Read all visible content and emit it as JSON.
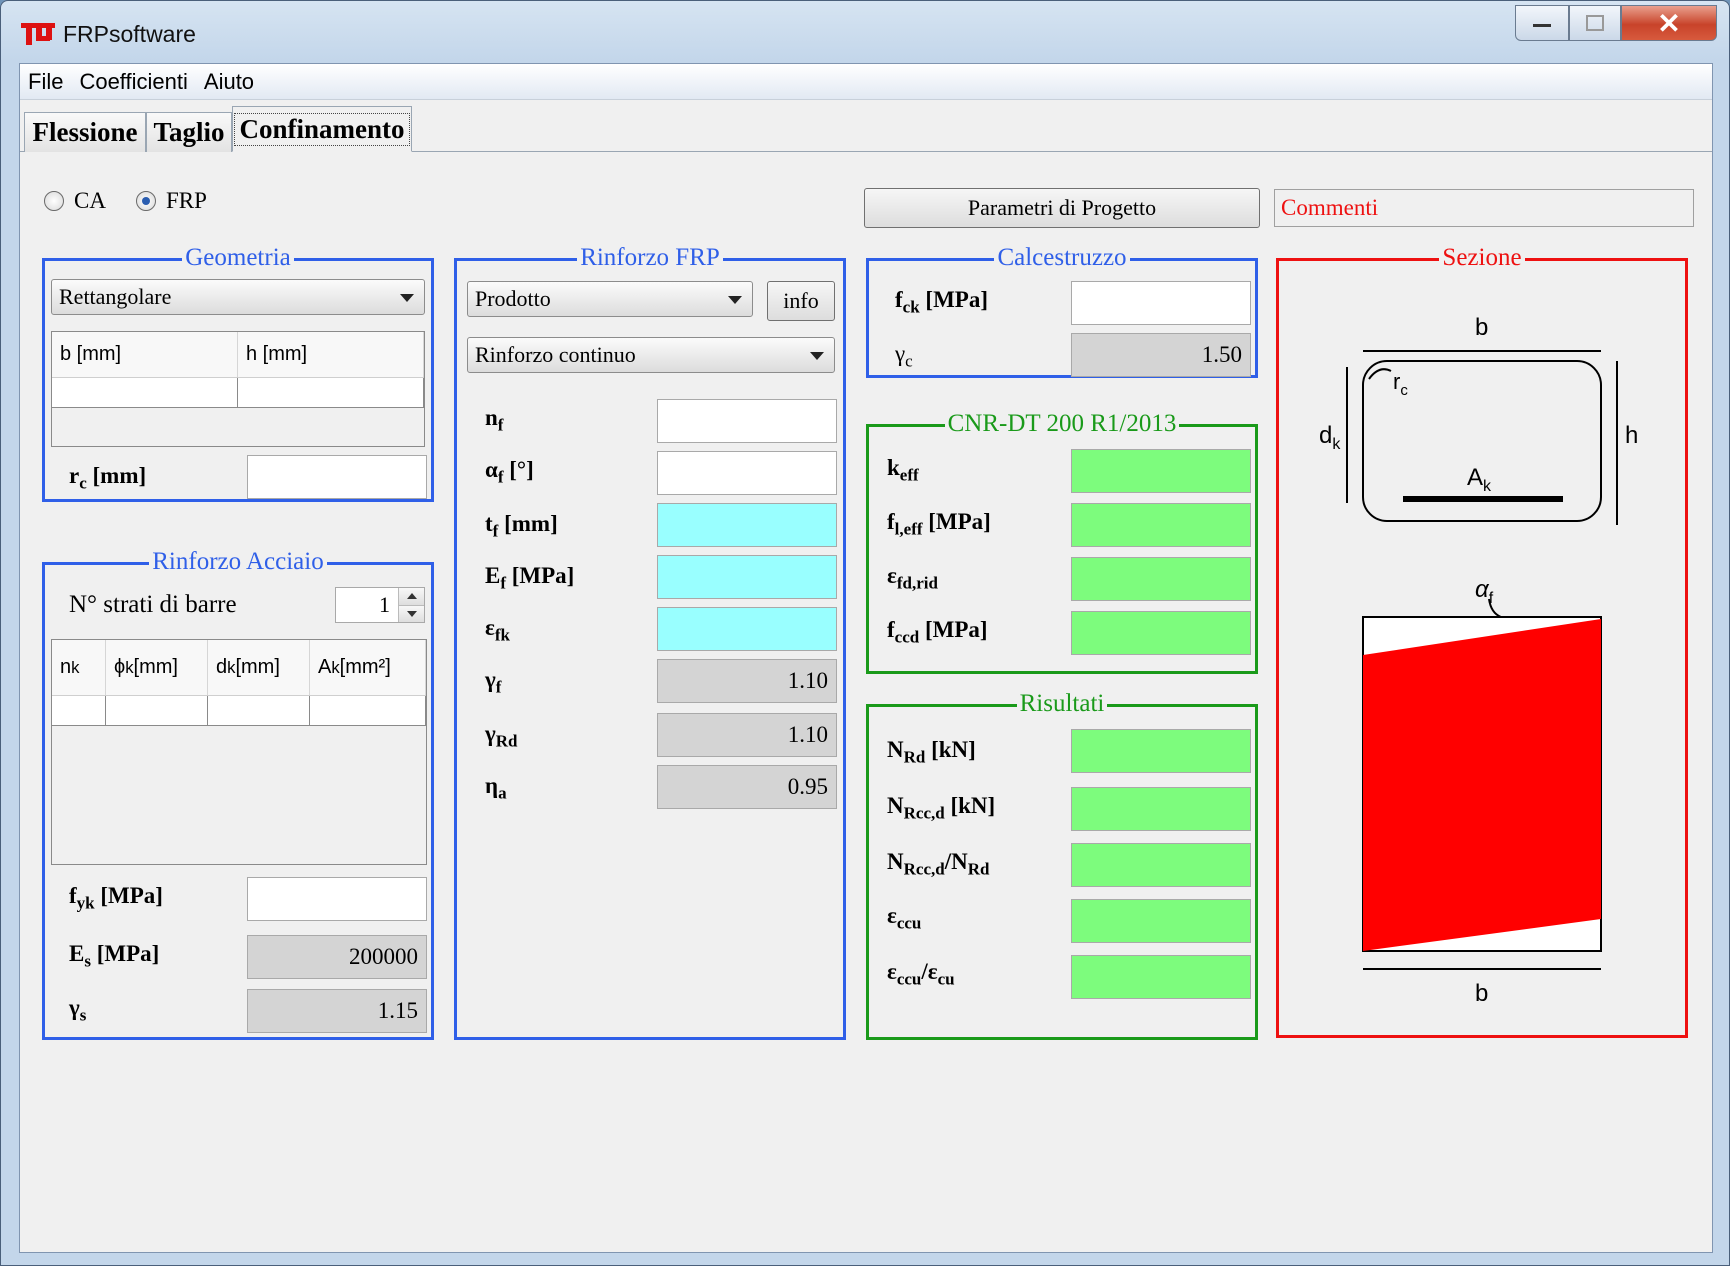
{
  "window": {
    "title": "FRPsoftware"
  },
  "menu": [
    "File",
    "Coefficienti",
    "Aiuto"
  ],
  "tabs": [
    "Flessione",
    "Taglio",
    "Confinamento"
  ],
  "mode": {
    "ca": "CA",
    "frp": "FRP",
    "selected": "FRP"
  },
  "buttons": {
    "parametri": "Parametri di Progetto",
    "info": "info"
  },
  "commenti": "Commenti",
  "geometria": {
    "legend": "Geometria",
    "shape": "Rettangolare",
    "col_b": "b [mm]",
    "col_h": "h [mm]",
    "rc_label": "r",
    "rc_sub": "c",
    "rc_unit": " [mm]"
  },
  "acciaio": {
    "legend": "Rinforzo Acciaio",
    "strati_label": "N° strati di barre",
    "strati_value": "1",
    "cols": [
      {
        "main": "n",
        "sub": "k",
        "unit": ""
      },
      {
        "main": "ϕ",
        "sub": "k",
        "unit": " [mm]"
      },
      {
        "main": "d",
        "sub": "k",
        "unit": " [mm]"
      },
      {
        "main": "A",
        "sub": "k",
        "unit": " [mm²]"
      }
    ],
    "fyk": {
      "main": "f",
      "sub": "yk",
      "unit": " [MPa]"
    },
    "es": {
      "main": "E",
      "sub": "s",
      "unit": " [MPa]",
      "value": "200000"
    },
    "gs": {
      "main": "γ",
      "sub": "s",
      "value": "1.15"
    }
  },
  "frp": {
    "legend": "Rinforzo FRP",
    "prodotto": "Prodotto",
    "tipo": "Rinforzo continuo",
    "nf": {
      "main": "n",
      "sub": "f",
      "unit": ""
    },
    "af": {
      "main": "α",
      "sub": "f",
      "unit": " [°]"
    },
    "tf": {
      "main": "t",
      "sub": "f",
      "unit": " [mm]"
    },
    "ef": {
      "main": "E",
      "sub": "f",
      "unit": " [MPa]"
    },
    "efk": {
      "main": "ε",
      "sub": "fk",
      "unit": ""
    },
    "gf": {
      "main": "γ",
      "sub": "f",
      "value": "1.10"
    },
    "grd": {
      "main": "γ",
      "sub": "Rd",
      "value": "1.10"
    },
    "na": {
      "main": "η",
      "sub": "a",
      "value": "0.95"
    }
  },
  "cls": {
    "legend": "Calcestruzzo",
    "fck": {
      "main": "f",
      "sub": "ck",
      "unit": " [MPa]"
    },
    "gc": {
      "main": "γ",
      "sub": "c",
      "value": "1.50"
    }
  },
  "cnr": {
    "legend": "CNR-DT 200 R1/2013",
    "keff": {
      "main": "k",
      "sub": "eff",
      "unit": ""
    },
    "fleff": {
      "main": "f",
      "sub": "l,eff",
      "unit": " [MPa]"
    },
    "efdrid": {
      "main": "ε",
      "sub": "fd,rid",
      "unit": ""
    },
    "fccd": {
      "main": "f",
      "sub": "ccd",
      "unit": " [MPa]"
    }
  },
  "risultati": {
    "legend": "Risultati",
    "nrd": {
      "main": "N",
      "sub": "Rd",
      "unit": " [kN]"
    },
    "nrccd": {
      "main": "N",
      "sub": "Rcc,d",
      "unit": " [kN]"
    },
    "ratio": {
      "main": "N",
      "sub": "Rcc,d",
      "mid": "/N",
      "sub2": "Rd"
    },
    "eccu": {
      "main": "ε",
      "sub": "ccu",
      "unit": ""
    },
    "eratio": {
      "main": "ε",
      "sub": "ccu",
      "mid": "/ε",
      "sub2": "cu"
    }
  },
  "sezione": {
    "legend": "Sezione",
    "b_top": "b",
    "h": "h",
    "dk": "d",
    "dk_sub": "k",
    "rc": "r",
    "rc_sub": "c",
    "ak": "A",
    "ak_sub": "k",
    "af": "α",
    "af_sub": "f",
    "b_bottom": "b"
  },
  "colors": {
    "blue": "#2f5fe8",
    "green": "#1a9a1a",
    "red": "#ee1111",
    "lime": "#7dfc7d",
    "cyan": "#99ffff"
  }
}
